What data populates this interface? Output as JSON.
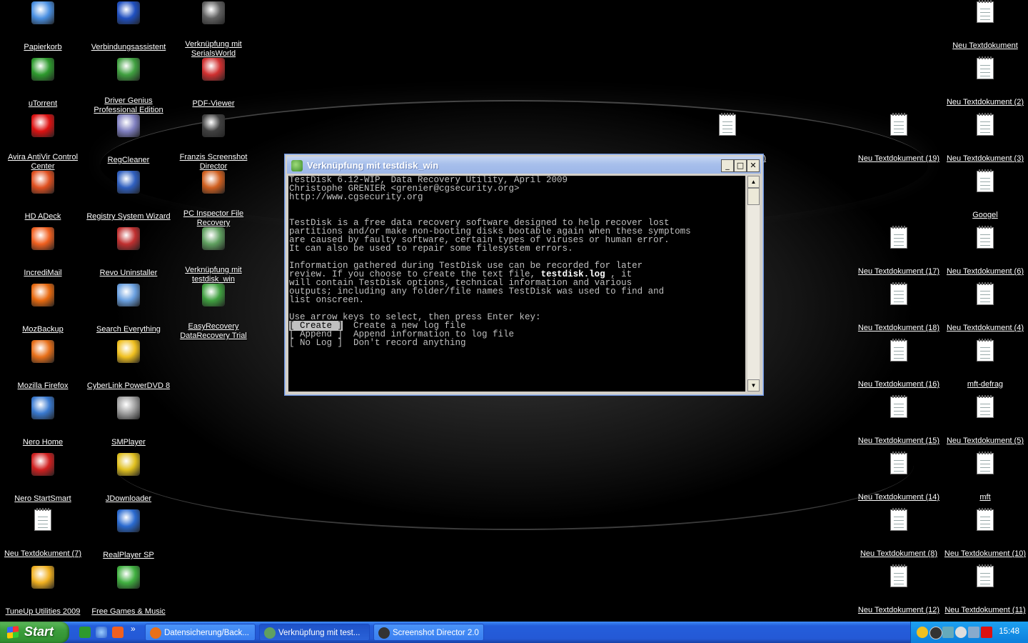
{
  "desktop": {
    "icons_left": [
      {
        "label": "Papierkorb",
        "icon": "recycle-bin-icon",
        "color": "#4a90e2"
      },
      {
        "label": "uTorrent",
        "icon": "utorrent-icon",
        "color": "#2e9a2e"
      },
      {
        "label": "Avira AntiVir Control Center",
        "icon": "avira-icon",
        "color": "#d11"
      },
      {
        "label": "HD ADeck",
        "icon": "hd-adeck-icon",
        "color": "#e05020"
      },
      {
        "label": "IncrediMail",
        "icon": "incredimail-icon",
        "color": "#f06020"
      },
      {
        "label": "MozBackup",
        "icon": "mozbackup-icon",
        "color": "#e86a10"
      },
      {
        "label": "Mozilla Firefox",
        "icon": "firefox-icon",
        "color": "#e8701a"
      },
      {
        "label": "Nero Home",
        "icon": "nero-home-icon",
        "color": "#3a7ad0"
      },
      {
        "label": "Nero StartSmart",
        "icon": "nero-startsmart-icon",
        "color": "#d02020"
      },
      {
        "label": "Neu Textdokument (7)",
        "icon": "text-document-icon",
        "color": "#ffffff"
      },
      {
        "label": "TuneUp Utilities 2009",
        "icon": "tuneup-icon",
        "color": "#f0b020"
      }
    ],
    "icons_col2": [
      {
        "label": "Verbindungsassistent",
        "icon": "connection-wizard-icon",
        "color": "#2050c0"
      },
      {
        "label": "Driver Genius Professional Edition",
        "icon": "driver-genius-icon",
        "color": "#40a040"
      },
      {
        "label": "RegCleaner",
        "icon": "regcleaner-icon",
        "color": "#8080c0"
      },
      {
        "label": "Registry System Wizard",
        "icon": "registry-wizard-icon",
        "color": "#3060c0"
      },
      {
        "label": "Revo Uninstaller",
        "icon": "revo-uninstaller-icon",
        "color": "#c03030"
      },
      {
        "label": "Search Everything",
        "icon": "search-everything-icon",
        "color": "#6aa0e0"
      },
      {
        "label": "CyberLink PowerDVD 8",
        "icon": "powerdvd-icon",
        "color": "#f0c020"
      },
      {
        "label": "SMPlayer",
        "icon": "smplayer-icon",
        "color": "#a0a0a0"
      },
      {
        "label": "JDownloader",
        "icon": "jdownloader-icon",
        "color": "#e0c020"
      },
      {
        "label": "RealPlayer SP",
        "icon": "realplayer-icon",
        "color": "#2a6ad0"
      },
      {
        "label": "Free Games & Music",
        "icon": "free-games-icon",
        "color": "#40b040"
      }
    ],
    "icons_col3": [
      {
        "label": "Verknüpfung mit SerialsWorld",
        "icon": "serialsworld-icon",
        "color": "#606060"
      },
      {
        "label": "PDF-Viewer",
        "icon": "pdf-viewer-icon",
        "color": "#d03030"
      },
      {
        "label": "Franzis Screenshot Director",
        "icon": "screenshot-director-icon",
        "color": "#404040"
      },
      {
        "label": "PC Inspector File Recovery",
        "icon": "pc-inspector-icon",
        "color": "#d06020"
      },
      {
        "label": "Verknüpfung mit testdisk_win",
        "icon": "testdisk-icon",
        "color": "#60a060"
      },
      {
        "label": "EasyRecovery DataRecovery Trial",
        "icon": "easyrecovery-icon",
        "color": "#40a040"
      }
    ],
    "icon_mid": {
      "label": "Neu Textdokument (9)",
      "icon": "text-document-icon"
    },
    "icons_right_a": [
      {
        "label": "Neu Textdokument (19)"
      },
      {
        "label": "Neu Textdokument (17)"
      },
      {
        "label": "Neu Textdokument (18)"
      },
      {
        "label": "Neu Textdokument (16)"
      },
      {
        "label": "Neu Textdokument (15)"
      },
      {
        "label": "Neu Textdokument (14)"
      },
      {
        "label": "Neu Textdokument (8)"
      },
      {
        "label": "Neu Textdokument (12)"
      }
    ],
    "icons_right_b": [
      {
        "label": "Neu Textdokument"
      },
      {
        "label": "Neu Textdokument (2)"
      },
      {
        "label": "Neu Textdokument (3)"
      },
      {
        "label": "Googel"
      },
      {
        "label": "Neu Textdokument (6)"
      },
      {
        "label": "Neu Textdokument (4)"
      },
      {
        "label": "mft-defrag"
      },
      {
        "label": "Neu Textdokument (5)"
      },
      {
        "label": "mft"
      },
      {
        "label": "Neu Textdokument (10)"
      },
      {
        "label": "Neu Textdokument (11)"
      }
    ]
  },
  "window": {
    "title": "Verknüpfung mit testdisk_win",
    "minimize": "_",
    "maximize": "□",
    "close": "✕",
    "console_lines": [
      "TestDisk 6.12-WIP, Data Recovery Utility, April 2009",
      "Christophe GRENIER <grenier@cgsecurity.org>",
      "http://www.cgsecurity.org",
      "",
      "",
      "TestDisk is a free data recovery software designed to help recover lost",
      "partitions and/or make non-booting disks bootable again when these symptoms",
      "are caused by faulty software, certain types of viruses or human error.",
      "It can also be used to repair some filesystem errors.",
      "",
      "Information gathered during TestDisk use can be recorded for later",
      "review. If you choose to create the text file,",
      "will contain TestDisk options, technical information and various",
      "outputs; including any folder/file names TestDisk was used to find and",
      "list onscreen.",
      "",
      "Use arrow keys to select, then press Enter key:"
    ],
    "logfile_name": "testdisk.log",
    "logfile_suffix": " , it",
    "menu": [
      {
        "key": "[ Create ]",
        "desc": "Create a new log file",
        "selected": true
      },
      {
        "key": "[ Append ]",
        "desc": "Append information to log file",
        "selected": false
      },
      {
        "key": "[ No Log ]",
        "desc": "Don't record anything",
        "selected": false
      }
    ],
    "scroll_up": "▲",
    "scroll_down": "▼"
  },
  "taskbar": {
    "start_label": "Start",
    "quick_launch": [
      "utorrent-icon",
      "ie-icon",
      "mail-icon"
    ],
    "chevron": "»",
    "tasks": [
      {
        "label": "Datensicherung/Back...",
        "icon": "firefox-icon",
        "active": false
      },
      {
        "label": "Verknüpfung mit test...",
        "icon": "testdisk-icon",
        "active": true
      },
      {
        "label": "Screenshot Director 2.0",
        "icon": "screenshot-director-icon",
        "active": false
      }
    ],
    "tray_icons": [
      "msn-icon",
      "screenshot-director-icon",
      "network-icon",
      "avira-umbrella-icon",
      "safely-remove-icon",
      "avira-icon"
    ],
    "clock": "15:48"
  },
  "colors": {
    "taskbar_blue": "#245edb",
    "start_green": "#3c9e3c",
    "console_bg": "#000000",
    "console_text": "#c0c0c0",
    "title_bar": "#a7bfeb"
  }
}
